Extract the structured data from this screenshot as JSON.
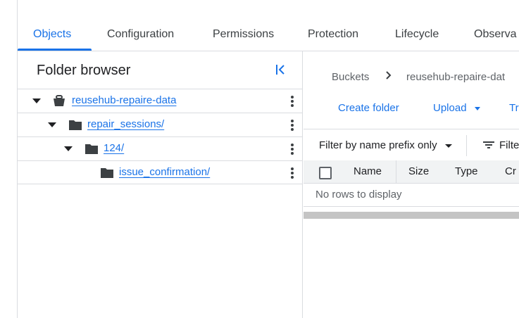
{
  "tabs": [
    "Objects",
    "Configuration",
    "Permissions",
    "Protection",
    "Lifecycle",
    "Observa"
  ],
  "folder_browser": {
    "title": "Folder browser",
    "items": [
      {
        "label": "reusehub-repaire-data",
        "type": "bucket"
      },
      {
        "label": "repair_sessions/",
        "type": "folder"
      },
      {
        "label": "124/",
        "type": "folder"
      },
      {
        "label": "issue_confirmation/",
        "type": "folder"
      }
    ]
  },
  "breadcrumb": {
    "root": "Buckets",
    "current": "reusehub-repaire-dat"
  },
  "actions": {
    "create_folder": "Create folder",
    "upload": "Upload",
    "transfer": "Tr"
  },
  "filter": {
    "mode": "Filter by name prefix only",
    "filter_label": "Filte"
  },
  "table": {
    "columns": [
      "Name",
      "Size",
      "Type",
      "Cr"
    ],
    "empty_message": "No rows to display"
  }
}
